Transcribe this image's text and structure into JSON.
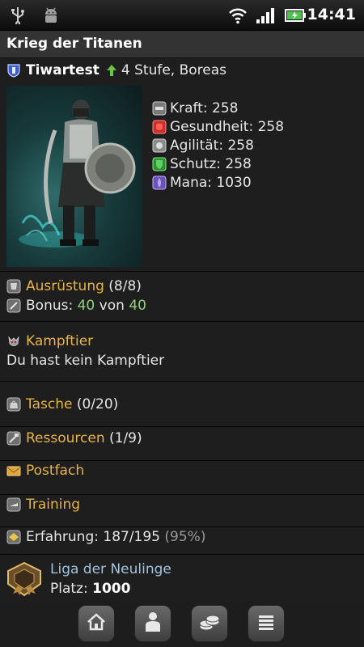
{
  "status_bar": {
    "time": "14:41",
    "icons": [
      "usb-icon",
      "android-debug-icon",
      "wifi-icon",
      "signal-icon",
      "battery-icon"
    ]
  },
  "app": {
    "title": "Krieg der Titanen"
  },
  "hero": {
    "name": "Tiwartest",
    "level_text": "4 Stufe, Boreas",
    "stats": [
      {
        "label": "Kraft:",
        "value": "258",
        "icon": "strength-icon",
        "color": "#8a8a8a"
      },
      {
        "label": "Gesundheit:",
        "value": "258",
        "icon": "health-icon",
        "color": "#d0342c"
      },
      {
        "label": "Agilität:",
        "value": "258",
        "icon": "agility-icon",
        "color": "#9a9a9a"
      },
      {
        "label": "Schutz:",
        "value": "258",
        "icon": "protection-icon",
        "color": "#3aa83a"
      },
      {
        "label": "Mana:",
        "value": "1030",
        "icon": "mana-icon",
        "color": "#8a6fc8"
      }
    ]
  },
  "equipment": {
    "label": "Ausrüstung",
    "count": "(8/8)",
    "bonus_label": "Bonus:",
    "bonus_value": "40",
    "bonus_of": "von",
    "bonus_max": "40"
  },
  "pet": {
    "label": "Kampftier",
    "text": "Du hast kein Kampftier"
  },
  "bag": {
    "label": "Tasche",
    "count": "(0/20)"
  },
  "resources": {
    "label": "Ressourcen",
    "count": "(1/9)"
  },
  "mail": {
    "label": "Postfach"
  },
  "training": {
    "label": "Training"
  },
  "experience": {
    "label": "Erfahrung:",
    "value": "187/195",
    "percent": "(95%)",
    "progress": 0.95
  },
  "league": {
    "name": "Liga der Neulinge",
    "place_label": "Platz:",
    "place_value": "1000"
  },
  "bottom_nav": [
    "home-icon",
    "character-icon",
    "coins-icon",
    "menu-icon"
  ],
  "colors": {
    "gold": "#e8b347",
    "green": "#8ed17a",
    "league_blue": "#9fc3e0"
  }
}
